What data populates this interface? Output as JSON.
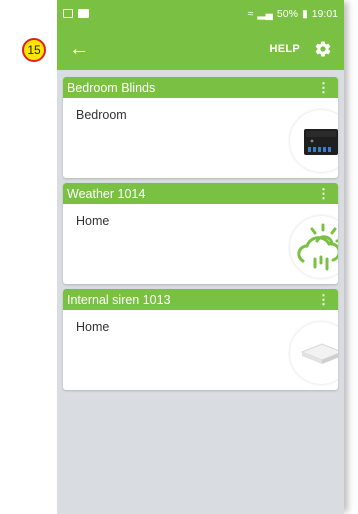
{
  "annotation": {
    "badge_number": "15"
  },
  "status_bar": {
    "battery": "50%",
    "time": "19:01"
  },
  "toolbar": {
    "help_label": "HELP"
  },
  "devices": [
    {
      "name": "Bedroom Blinds",
      "location": "Bedroom",
      "icon": "blind-module-icon"
    },
    {
      "name": "Weather 1014",
      "location": "Home",
      "icon": "weather-cloud-sun-rain-icon"
    },
    {
      "name": "Internal siren 1013",
      "location": "Home",
      "icon": "siren-device-icon"
    }
  ],
  "colors": {
    "accent": "#7ac143",
    "background": "#d9dde2",
    "badge": "#ffe500",
    "badge_border": "#e02020"
  }
}
